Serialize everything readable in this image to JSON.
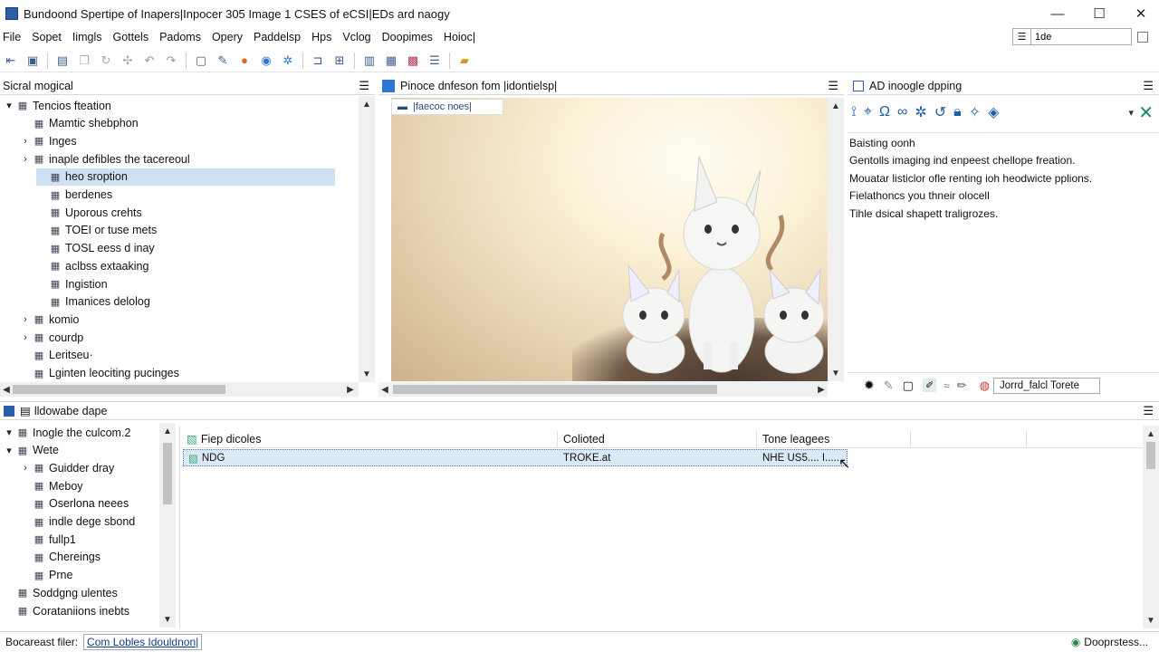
{
  "window": {
    "title": "Bundoond Spertipe of Inapers|Inpocer 305 Image 1 CSES of eCSI|EDs ard naogy",
    "controls": {
      "minimize": "—",
      "maximize": "☐",
      "close": "✕"
    }
  },
  "menu": [
    "File",
    "Sopet",
    "Iimgls",
    "Gottels",
    "Padoms",
    "Opery",
    "Paddelsp",
    "Hps",
    "Vclog",
    "Doopimes",
    "Hoioc|"
  ],
  "menu_search": {
    "value": "1de"
  },
  "left_pane": {
    "title": "Sicral mogical",
    "items": [
      {
        "label": "Tencios fteation",
        "exp": "▾",
        "indent": 0
      },
      {
        "label": "Mamtic shebphon",
        "exp": "",
        "indent": 1
      },
      {
        "label": "Inges",
        "exp": "›",
        "indent": 1
      },
      {
        "label": "inaple defibles the tacereoul",
        "exp": "›",
        "indent": 1
      },
      {
        "label": "heo sroption",
        "exp": "",
        "indent": 2,
        "selected": true
      },
      {
        "label": "berdenes",
        "exp": "",
        "indent": 2
      },
      {
        "label": "Uporous crehts",
        "exp": "",
        "indent": 2
      },
      {
        "label": "TOEI or tuse mets",
        "exp": "",
        "indent": 2
      },
      {
        "label": "TOSL eess d inay",
        "exp": "",
        "indent": 2
      },
      {
        "label": "aclbss extaaking",
        "exp": "",
        "indent": 2
      },
      {
        "label": "Ingistion",
        "exp": "",
        "indent": 2
      },
      {
        "label": "Imanices delolog",
        "exp": "",
        "indent": 2
      },
      {
        "label": "komio",
        "exp": "›",
        "indent": 1
      },
      {
        "label": "courdp",
        "exp": "›",
        "indent": 1
      },
      {
        "label": "Leritseu·",
        "exp": "",
        "indent": 1
      },
      {
        "label": "Lginten leociting pucinges",
        "exp": "",
        "indent": 1
      }
    ]
  },
  "center_pane": {
    "title": "Pinoce dnfeson fom |idontielsp|",
    "tab": "|faecoc noes|"
  },
  "right_pane": {
    "title": "AD inoogle dpping",
    "lines": [
      "Baisting oonh",
      "Gentolls imaging ind enpeest chellope freation.",
      "Mouatar listiclor ofle renting ioh heodwicte pplions.",
      "Fielathoncs you thneir olocell",
      "Tihle dsical shapett traligrozes."
    ],
    "footer_label": "Jorrd_falcl Torete"
  },
  "bottom_pane": {
    "title": "lldowabe dape",
    "tree": [
      {
        "label": "Inogle the culcom.2",
        "exp": "▾",
        "indent": 0
      },
      {
        "label": "Wete",
        "exp": "▾",
        "indent": 0
      },
      {
        "label": "Guidder dray",
        "exp": "›",
        "indent": 1
      },
      {
        "label": "Meboy",
        "exp": "",
        "indent": 1
      },
      {
        "label": "Oserlona neees",
        "exp": "",
        "indent": 1
      },
      {
        "label": "indle dege sbond",
        "exp": "",
        "indent": 1
      },
      {
        "label": "fullp1",
        "exp": "",
        "indent": 1
      },
      {
        "label": "Chereings",
        "exp": "",
        "indent": 1
      },
      {
        "label": "Prne",
        "exp": "",
        "indent": 1
      },
      {
        "label": "Soddgng ulentes",
        "exp": "",
        "indent": 0
      },
      {
        "label": "Corataniions inebts",
        "exp": "",
        "indent": 0
      }
    ],
    "table": {
      "columns": [
        "Fiep dicoles",
        "Colioted",
        "Tone leagees"
      ],
      "rows": [
        [
          "NDG",
          "TROKE.at",
          "NHE US5.... I....."
        ]
      ]
    }
  },
  "status": {
    "label": "Bocareast filer:",
    "link": "Com Lobles Idouldnon|",
    "right": "Dooprstess..."
  }
}
